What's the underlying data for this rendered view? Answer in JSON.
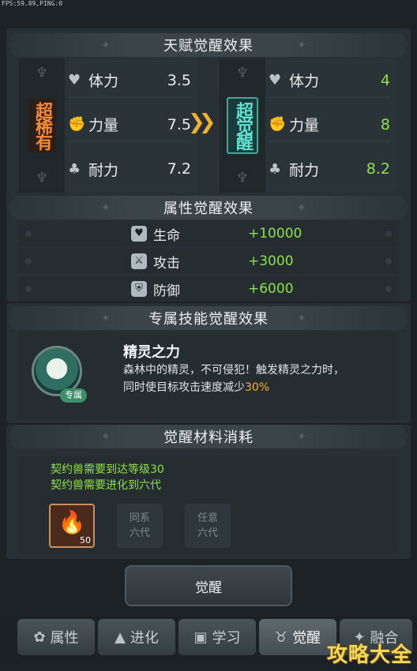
{
  "fps": "FPS:59.89,PING:0",
  "talent": {
    "header": "天赋觉醒效果",
    "left": {
      "tier": "超稀有",
      "stats": [
        {
          "icon": "heart-icon",
          "label": "体力",
          "value": "3.5"
        },
        {
          "icon": "fist-icon",
          "label": "力量",
          "value": "7.5"
        },
        {
          "icon": "shield-plant-icon",
          "label": "耐力",
          "value": "7.2"
        }
      ]
    },
    "right": {
      "tier": "超觉醒",
      "stats": [
        {
          "icon": "heart-icon",
          "label": "体力",
          "value": "4"
        },
        {
          "icon": "fist-icon",
          "label": "力量",
          "value": "8"
        },
        {
          "icon": "shield-plant-icon",
          "label": "耐力",
          "value": "8.2"
        }
      ]
    }
  },
  "attribute": {
    "header": "属性觉醒效果",
    "rows": [
      {
        "label": "生命",
        "value": "+10000"
      },
      {
        "label": "攻击",
        "value": "+3000"
      },
      {
        "label": "防御",
        "value": "+6000"
      }
    ]
  },
  "skill": {
    "header": "专属技能觉醒效果",
    "tag": "专属",
    "name": "精灵之力",
    "desc_line1": "森林中的精灵，不可侵犯！触发精灵之力时，",
    "desc_line2_pre": "同时使目标攻击速度减少",
    "desc_highlight": "30%"
  },
  "materials": {
    "header": "觉醒材料消耗",
    "req1": "契约兽需要到达等级30",
    "req2": "契约兽需要进化到六代",
    "item_count": "50",
    "slot2_line1": "同系",
    "slot2_line2": "六代",
    "slot3_line1": "任意",
    "slot3_line2": "六代"
  },
  "awaken_button": "觉醒",
  "tabs": [
    {
      "label": "属性",
      "icon": "paw-icon"
    },
    {
      "label": "进化",
      "icon": "arrow-up-icon"
    },
    {
      "label": "学习",
      "icon": "book-icon"
    },
    {
      "label": "觉醒",
      "icon": "beast-head-icon"
    },
    {
      "label": "融合",
      "icon": "merge-icon"
    }
  ],
  "watermark": "攻略大全"
}
